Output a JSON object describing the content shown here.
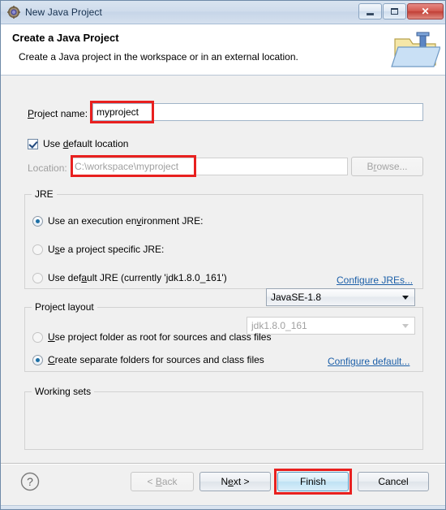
{
  "window": {
    "title": "New Java Project",
    "icon": "java-project-icon",
    "controls": {
      "minimize": "Minimize",
      "maximize": "Maximize",
      "close": "Close",
      "close_glyph": "✕"
    }
  },
  "header": {
    "title": "Create a Java Project",
    "subtitle": "Create a Java project in the workspace or in an external location.",
    "icon": "java-project-folder-icon"
  },
  "form": {
    "project_name": {
      "label_before": "P",
      "label_after": "roject name:",
      "value": "myproject",
      "placeholder": ""
    },
    "use_default_location": {
      "label_before": "Use ",
      "label_mnemonic": "d",
      "label_after": "efault location",
      "checked": true
    },
    "location": {
      "label": "Location:",
      "value": "C:\\workspace\\myproject",
      "disabled": true
    },
    "browse_button": {
      "label_before": "B",
      "label_mnemonic": "r",
      "label_after": "owse...",
      "disabled": true
    }
  },
  "jre_group": {
    "title": "JRE",
    "options": [
      {
        "name": "execution-environment",
        "label_parts": [
          "Use an execution en",
          "v",
          "ironment JRE:"
        ],
        "selected": true,
        "value": "JavaSE-1.8",
        "control": "combo",
        "control_disabled": false
      },
      {
        "name": "project-specific",
        "label_parts": [
          "U",
          "s",
          "e a project specific JRE:"
        ],
        "selected": false,
        "value": "jdk1.8.0_161",
        "control": "combo",
        "control_disabled": true
      },
      {
        "name": "default-jre",
        "label_parts": [
          "Use def",
          "a",
          "ult JRE (currently 'jdk1.8.0_161')"
        ],
        "selected": false,
        "control": "none"
      }
    ],
    "configure_link": "Configure JREs..."
  },
  "project_layout_group": {
    "title": "Project layout",
    "options": [
      {
        "name": "project-folder-root",
        "label_parts": [
          "",
          "U",
          "se project folder as root for sources and class files"
        ],
        "selected": false
      },
      {
        "name": "separate-folders",
        "label_parts": [
          "",
          "C",
          "reate separate folders for sources and class files"
        ],
        "selected": true
      }
    ],
    "configure_link": "Configure default..."
  },
  "working_sets_group": {
    "title": "Working sets"
  },
  "footer": {
    "help_icon": "help-icon",
    "help_glyph": "?",
    "buttons": [
      {
        "name": "back",
        "label_before": "< ",
        "label_mnemonic": "B",
        "label_after": "ack",
        "disabled": true,
        "default": false
      },
      {
        "name": "next",
        "label_before": "N",
        "label_mnemonic": "e",
        "label_after": "xt >",
        "disabled": false,
        "default": false
      },
      {
        "name": "finish",
        "label_before": "",
        "label_mnemonic": "",
        "label_after": "Finish",
        "disabled": false,
        "default": true
      },
      {
        "name": "cancel",
        "label_before": "",
        "label_mnemonic": "",
        "label_after": "Cancel",
        "disabled": false,
        "default": false
      }
    ]
  },
  "annotations": {
    "color": "#e8201f",
    "boxes": [
      "project-name-value",
      "location-value",
      "finish-button"
    ]
  }
}
